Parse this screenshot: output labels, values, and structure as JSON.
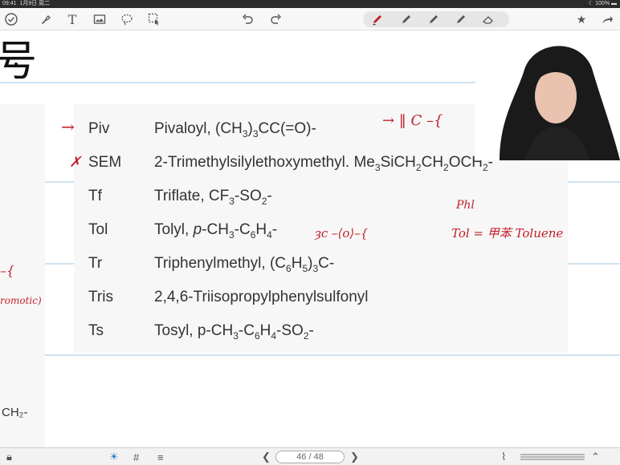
{
  "status": {
    "time": "09:41",
    "date": "1月9日 周二",
    "battery": "100%"
  },
  "heading_fragment": "号",
  "table": {
    "rows": [
      {
        "abbr": "Piv",
        "desc": "Pivaloyl, (CH<sub>3</sub>)<sub>3</sub>CC(=O)-"
      },
      {
        "abbr": "SEM",
        "desc": "2-Trimethylsilylethoxymethyl. Me<sub>3</sub>SiCH<sub>2</sub>CH<sub>2</sub>OCH<sub>2</sub>-"
      },
      {
        "abbr": "Tf",
        "desc": "Triflate, CF<sub>3</sub>-SO<sub>2</sub>-"
      },
      {
        "abbr": "Tol",
        "desc": "Tolyl, <i>p</i>-CH<sub>3</sub>-C<sub>6</sub>H<sub>4</sub>-"
      },
      {
        "abbr": "Tr",
        "desc": "Triphenylmethyl, (C<sub>6</sub>H<sub>5</sub>)<sub>3</sub>C-"
      },
      {
        "abbr": "Tris",
        "desc": "2,4,6-Triisopropylphenylsulfonyl"
      },
      {
        "abbr": "Ts",
        "desc": "Tosyl, p-CH<sub>3</sub>-C<sub>6</sub>H<sub>4</sub>-SO<sub>2</sub>-"
      }
    ]
  },
  "annotations": {
    "piv_marks": "→",
    "sem_mark": "✗",
    "piv_struct": "→  ‖ C –{",
    "tol_struct": "ȝc –⟨o⟩–{",
    "phl": "Phl",
    "tol_eq": "Tol = 甲苯  Toluene",
    "left_brace": "–{",
    "left_partial": "romotic)"
  },
  "left_edge_text": "CH₂-",
  "page": {
    "indicator": "46 / 48"
  },
  "colors": {
    "ink": "#c21f2a",
    "toolbar_bg": "#f7f7f7",
    "line": "#cfe2f0"
  }
}
